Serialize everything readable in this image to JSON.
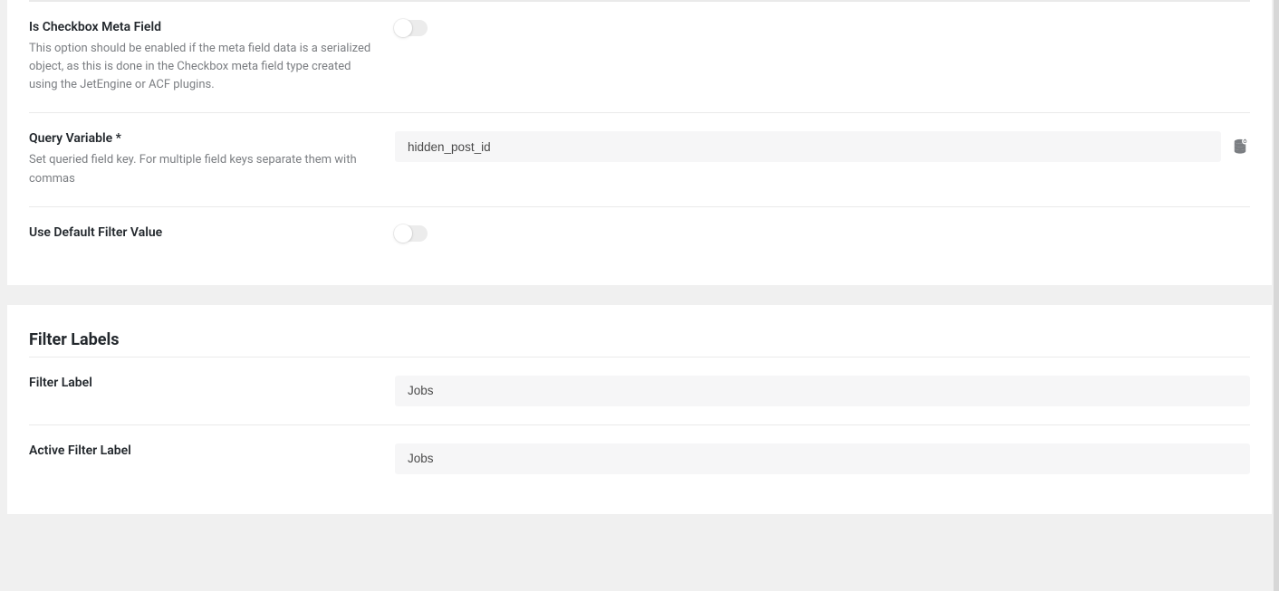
{
  "settings": {
    "checkbox_meta": {
      "title": "Is Checkbox Meta Field",
      "desc": "This option should be enabled if the meta field data is a serialized object, as this is done in the Checkbox meta field type created using the JetEngine or ACF plugins.",
      "value": false
    },
    "query_variable": {
      "title": "Query Variable *",
      "desc": "Set queried field key. For multiple field keys separate them with commas",
      "value": "hidden_post_id"
    },
    "use_default": {
      "title": "Use Default Filter Value",
      "value": false
    }
  },
  "labels": {
    "section_title": "Filter Labels",
    "filter_label": {
      "title": "Filter Label",
      "value": "Jobs"
    },
    "active_filter_label": {
      "title": "Active Filter Label",
      "value": "Jobs"
    }
  }
}
